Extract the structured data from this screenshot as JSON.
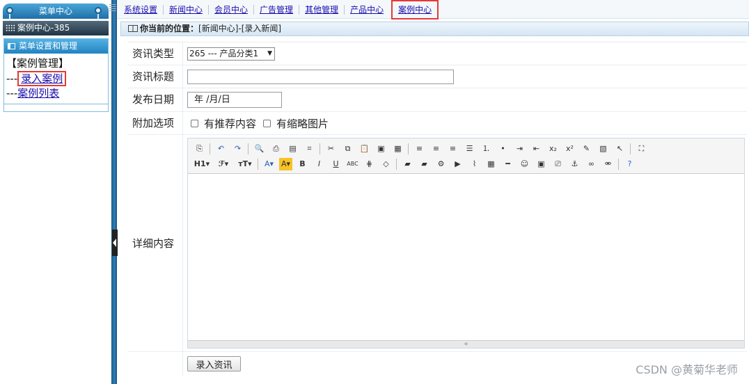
{
  "sidebar": {
    "menu_center": "菜单中心",
    "case_center_bar": "案例中心-385",
    "settings_header": "菜单设置和管理",
    "tree_root": "【案例管理】",
    "items": [
      {
        "prefix": "---",
        "label": "录入案例"
      },
      {
        "prefix": "---",
        "label": "案例列表"
      }
    ]
  },
  "topnav": {
    "items": [
      "系统设置",
      "新闻中心",
      "会员中心",
      "广告管理",
      "其他管理",
      "产品中心",
      "案例中心"
    ],
    "active": "案例中心"
  },
  "breadcrumb": {
    "label": "你当前的位置：",
    "path": "[新闻中心]-[录入新闻]"
  },
  "form": {
    "type_label": "资讯类型",
    "type_value": "265 --- 产品分类1",
    "title_label": "资讯标题",
    "title_value": "",
    "date_label": "发布日期",
    "date_value": "年 /月/日",
    "options_label": "附加选项",
    "option_recommend": "有推荐内容",
    "option_thumbnail": "有缩略图片",
    "content_label": "详细内容",
    "submit_label": "录入资讯"
  },
  "editor": {
    "resize_glyph": "÷",
    "toolbar_row1": [
      "source-icon",
      "undo-icon",
      "redo-icon",
      "preview-icon",
      "print-icon",
      "template-icon",
      "code-icon",
      "cut-icon",
      "copy-icon",
      "paste-icon",
      "paste-text-icon",
      "paste-word-icon",
      "align-left-icon",
      "align-center-icon",
      "align-right-icon",
      "justify-icon",
      "ordered-list-icon",
      "unordered-list-icon",
      "indent-icon",
      "outdent-icon",
      "subscript-icon",
      "superscript-icon",
      "clear-format-icon",
      "select-all-icon",
      "cursor-icon",
      "fullscreen-icon"
    ],
    "toolbar_row2": [
      "heading-icon",
      "font-family-icon",
      "font-size-icon",
      "font-color-icon",
      "highlight-icon",
      "bold-icon",
      "italic-icon",
      "underline-icon",
      "strikethrough-icon",
      "line-height-icon",
      "eraser-icon",
      "image-icon",
      "multi-image-icon",
      "flash-icon",
      "media-icon",
      "attachment-icon",
      "table-icon",
      "hr-icon",
      "emoticon-icon",
      "map-icon",
      "pagebreak-icon",
      "anchor-icon",
      "link-icon",
      "unlink-icon",
      "help-icon"
    ]
  },
  "watermark": "CSDN @黄菊华老师",
  "colors": {
    "highlight_border": "#e53935",
    "link": "#1a0dab",
    "sidebar_blue": "#2383c0"
  }
}
